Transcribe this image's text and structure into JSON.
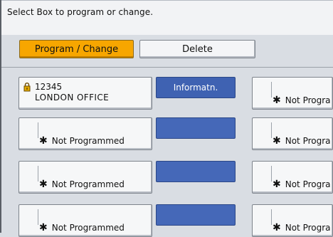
{
  "instruction": "Select Box to program or change.",
  "modes": {
    "program_change": "Program / Change",
    "delete": "Delete"
  },
  "boxes": {
    "box1": {
      "number": "12345",
      "name": "LONDON OFFICE",
      "info_label": "Informatn."
    },
    "not_programmed": "Not Programmed",
    "not_programmed_cut": "Not Progra"
  },
  "icons": {
    "lock": "lock-icon",
    "star": "asterisk-icon"
  },
  "colors": {
    "active_button": "#f7a600",
    "info_button": "#3f62b2"
  }
}
